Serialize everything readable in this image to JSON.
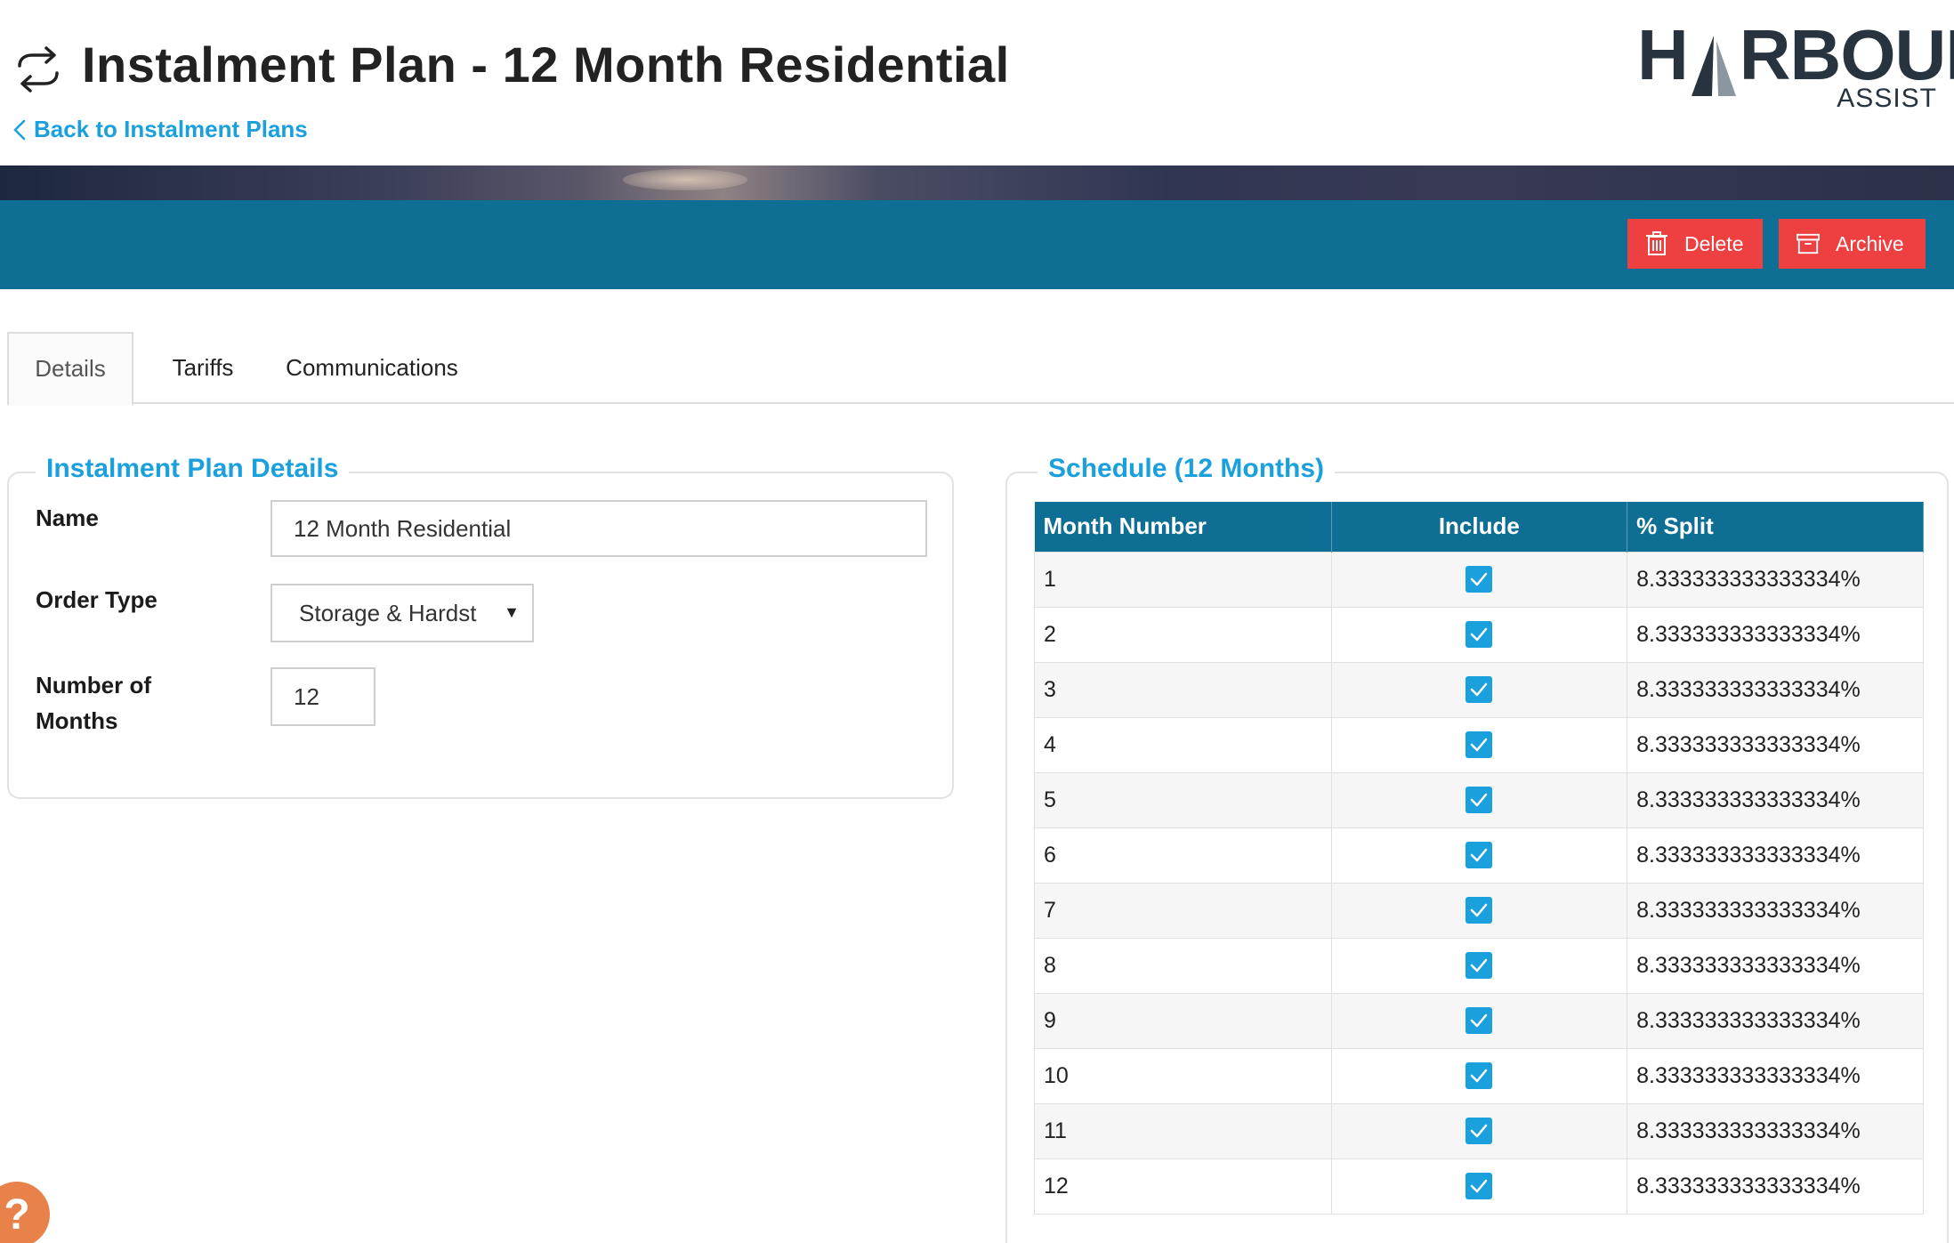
{
  "header": {
    "title": "Instalment Plan - 12 Month Residential",
    "back_link": "Back to Instalment Plans",
    "icon": "repeat-icon"
  },
  "logo": {
    "main_left": "H",
    "main_right": "RBOUR",
    "sub": "ASSIST"
  },
  "actions": {
    "delete_label": "Delete",
    "archive_label": "Archive",
    "button_color": "#ee4040",
    "bar_color": "#0f6e93"
  },
  "tabs": [
    {
      "label": "Details",
      "active": true
    },
    {
      "label": "Tariffs",
      "active": false
    },
    {
      "label": "Communications",
      "active": false
    }
  ],
  "details": {
    "legend": "Instalment Plan Details",
    "name_label": "Name",
    "name_value": "12 Month Residential",
    "order_type_label": "Order Type",
    "order_type_value": "Storage & Hardst",
    "months_label": "Number of Months",
    "months_value": "12"
  },
  "schedule": {
    "legend": "Schedule (12 Months)",
    "columns": [
      "Month Number",
      "Include",
      "% Split"
    ],
    "rows": [
      {
        "month": "1",
        "include": true,
        "split": "8.333333333333334%"
      },
      {
        "month": "2",
        "include": true,
        "split": "8.333333333333334%"
      },
      {
        "month": "3",
        "include": true,
        "split": "8.333333333333334%"
      },
      {
        "month": "4",
        "include": true,
        "split": "8.333333333333334%"
      },
      {
        "month": "5",
        "include": true,
        "split": "8.333333333333334%"
      },
      {
        "month": "6",
        "include": true,
        "split": "8.333333333333334%"
      },
      {
        "month": "7",
        "include": true,
        "split": "8.333333333333334%"
      },
      {
        "month": "8",
        "include": true,
        "split": "8.333333333333334%"
      },
      {
        "month": "9",
        "include": true,
        "split": "8.333333333333334%"
      },
      {
        "month": "10",
        "include": true,
        "split": "8.333333333333334%"
      },
      {
        "month": "11",
        "include": true,
        "split": "8.333333333333334%"
      },
      {
        "month": "12",
        "include": true,
        "split": "8.333333333333334%"
      }
    ]
  },
  "help": {
    "label": "?"
  }
}
